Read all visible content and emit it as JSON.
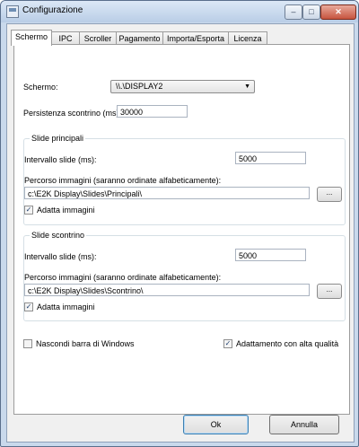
{
  "window": {
    "title": "Configurazione",
    "minimize_glyph": "–",
    "maximize_glyph": "□",
    "close_glyph": "✕",
    "app_icon": "window-app-icon"
  },
  "tabs": [
    {
      "label": "Schermo",
      "active": true
    },
    {
      "label": "IPC"
    },
    {
      "label": "Scroller"
    },
    {
      "label": "Pagamento"
    },
    {
      "label": "Importa/Esporta"
    },
    {
      "label": "Licenza"
    }
  ],
  "schermo": {
    "label": "Schermo:",
    "value": "\\\\.\\DISPLAY2",
    "arrow": "▼"
  },
  "persistenza": {
    "label": "Persistenza scontrino (ms):",
    "value": "30000"
  },
  "slide_principali": {
    "title": "Slide principali",
    "interval_label": "Intervallo slide (ms):",
    "interval_value": "5000",
    "path_label": "Percorso immagini (saranno ordinate alfabeticamente):",
    "path_value": "c:\\E2K Display\\Slides\\Principali\\",
    "browse_label": "...",
    "fit_label": "Adatta immagini",
    "fit_checked": "✓"
  },
  "slide_scontrino": {
    "title": "Slide scontrino",
    "interval_label": "Intervallo slide (ms):",
    "interval_value": "5000",
    "path_label": "Percorso immagini (saranno ordinate alfabeticamente):",
    "path_value": "c:\\E2K Display\\Slides\\Scontrino\\",
    "browse_label": "...",
    "fit_label": "Adatta immagini",
    "fit_checked": "✓"
  },
  "options": {
    "hide_taskbar_label": "Nascondi barra di Windows",
    "hide_taskbar_checked": "",
    "hq_label": "Adattamento con alta qualità",
    "hq_checked": "✓"
  },
  "buttons": {
    "ok": "Ok",
    "cancel": "Annulla"
  }
}
